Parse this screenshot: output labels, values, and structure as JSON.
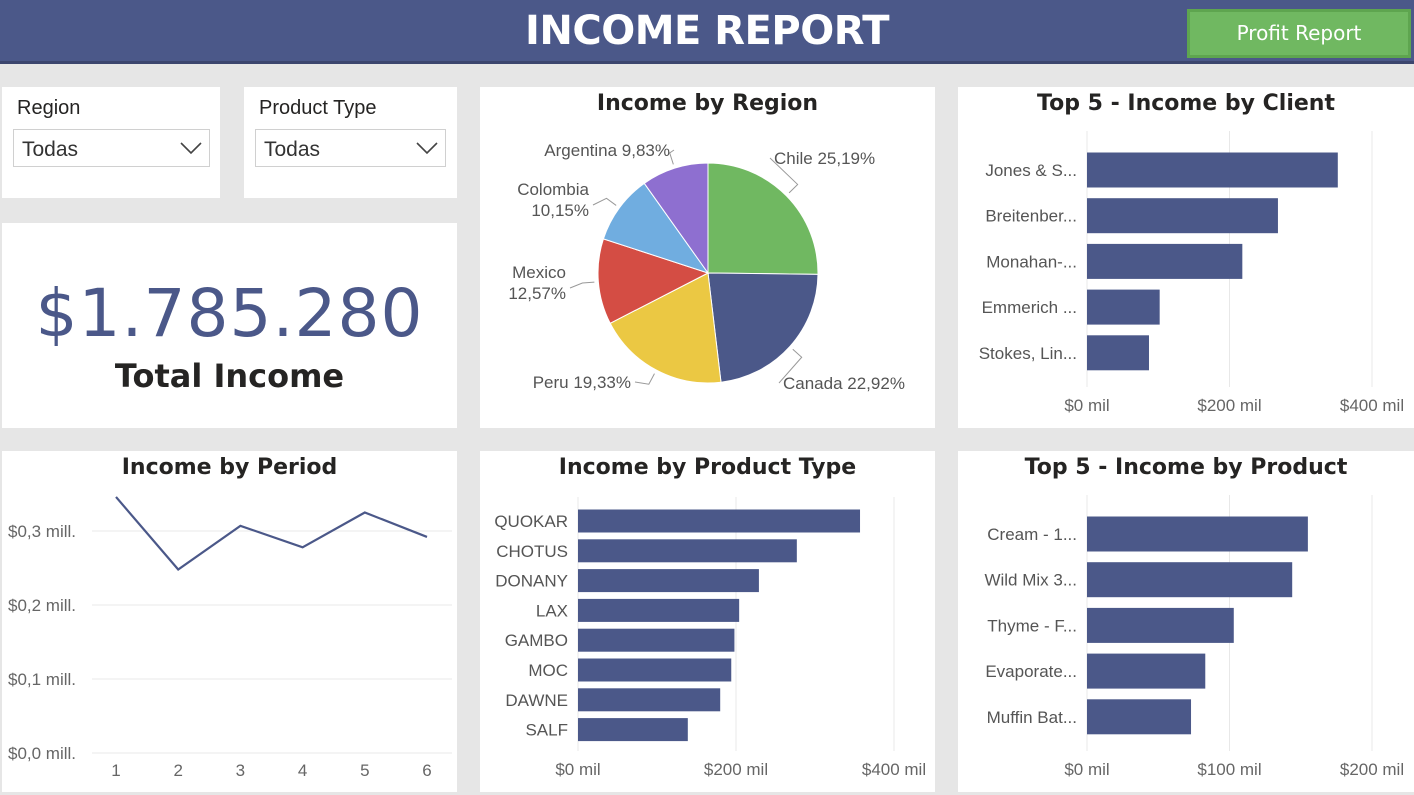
{
  "header": {
    "title": "INCOME REPORT",
    "profit_button": "Profit Report"
  },
  "colors": {
    "header_bg": "#4b5889",
    "bar": "#4b5889",
    "button": "#70b861",
    "pie": [
      "#70b861",
      "#4b5889",
      "#ebc843",
      "#d44d44",
      "#70ade0",
      "#8e6fd0"
    ]
  },
  "slicers": {
    "region": {
      "label": "Region",
      "value": "Todas"
    },
    "product_type": {
      "label": "Product Type",
      "value": "Todas"
    }
  },
  "kpi": {
    "value": "$1.785.280",
    "label": "Total Income"
  },
  "chart_data": [
    {
      "id": "income_by_region",
      "type": "pie",
      "title": "Income by Region",
      "labels": [
        "Chile",
        "Canada",
        "Peru",
        "Mexico",
        "Colombia",
        "Argentina"
      ],
      "values": [
        25.19,
        22.92,
        19.33,
        12.57,
        10.15,
        9.83
      ],
      "label_text": [
        "Chile 25,19%",
        "Canada 22,92%",
        "Peru 19,33%",
        "Mexico",
        "Colombia",
        "Argentina 9,83%"
      ],
      "label_text2": [
        "",
        "",
        "",
        "12,57%",
        "10,15%",
        ""
      ]
    },
    {
      "id": "top5_income_by_client",
      "type": "bar",
      "orientation": "horizontal",
      "title": "Top 5 - Income by Client",
      "categories": [
        "Jones & S...",
        "Breitenber...",
        "Monahan-...",
        "Emmerich ...",
        "Stokes, Lin..."
      ],
      "values": [
        352,
        268,
        218,
        102,
        87
      ],
      "xticks": [
        "$0 mil",
        "$200 mil",
        "$400 mil"
      ],
      "xlim": [
        0,
        400
      ]
    },
    {
      "id": "income_by_period",
      "type": "line",
      "title": "Income by Period",
      "x": [
        1,
        2,
        3,
        4,
        5,
        6
      ],
      "y": [
        0.346,
        0.248,
        0.307,
        0.278,
        0.325,
        0.292
      ],
      "yticks": [
        "$0,0 mill.",
        "$0,1 mill.",
        "$0,2 mill.",
        "$0,3 mill."
      ],
      "ylim": [
        0,
        0.3
      ],
      "xticks": [
        "1",
        "2",
        "3",
        "4",
        "5",
        "6"
      ]
    },
    {
      "id": "income_by_product_type",
      "type": "bar",
      "orientation": "horizontal",
      "title": "Income by Product Type",
      "categories": [
        "QUOKAR",
        "CHOTUS",
        "DONANY",
        "LAX",
        "GAMBO",
        "MOC",
        "DAWNE",
        "SALF"
      ],
      "values": [
        357,
        277,
        229,
        204,
        198,
        194,
        180,
        139
      ],
      "xticks": [
        "$0 mil",
        "$200 mil",
        "$400 mil"
      ],
      "xlim": [
        0,
        400
      ]
    },
    {
      "id": "top5_income_by_product",
      "type": "bar",
      "orientation": "horizontal",
      "title": "Top 5 - Income by Product",
      "categories": [
        "Cream - 1...",
        "Wild Mix 3...",
        "Thyme - F...",
        "Evaporate...",
        "Muffin Bat..."
      ],
      "values": [
        155,
        144,
        103,
        83,
        73
      ],
      "xticks": [
        "$0 mil",
        "$100 mil",
        "$200 mil"
      ],
      "xlim": [
        0,
        200
      ]
    }
  ]
}
